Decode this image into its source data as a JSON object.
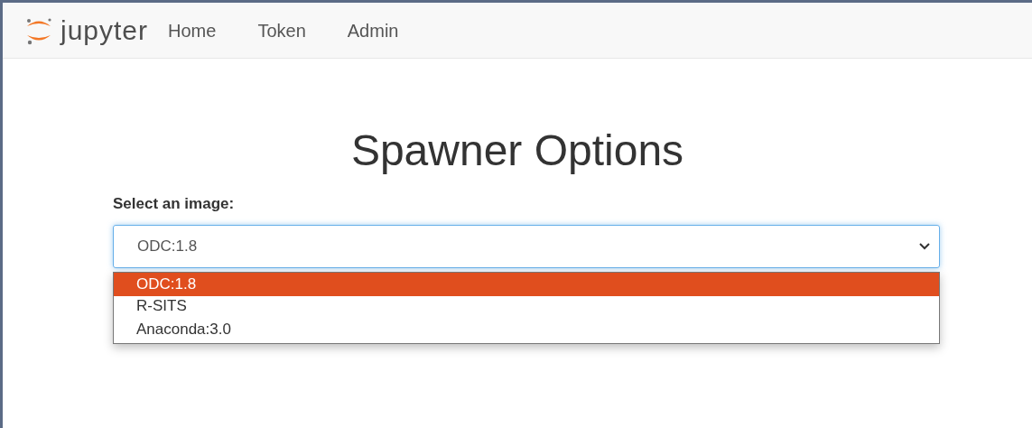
{
  "navbar": {
    "brand": "jupyter",
    "links": [
      {
        "label": "Home"
      },
      {
        "label": "Token"
      },
      {
        "label": "Admin"
      }
    ]
  },
  "title": "Spawner Options",
  "image_select": {
    "label": "Select an image:",
    "value": "ODC:1.8",
    "expanded": true,
    "options": [
      {
        "label": "ODC:1.8",
        "selected": true
      },
      {
        "label": "R-SITS",
        "selected": false
      },
      {
        "label": "Anaconda:3.0",
        "selected": false
      }
    ]
  }
}
